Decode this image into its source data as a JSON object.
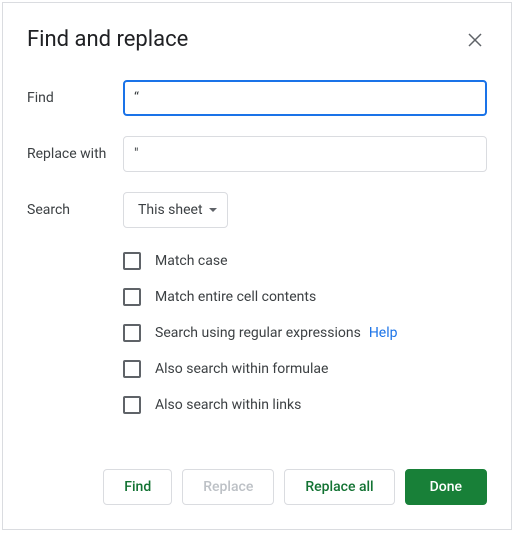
{
  "dialog": {
    "title": "Find and replace"
  },
  "fields": {
    "find_label": "Find",
    "find_value": "“",
    "replace_label": "Replace with",
    "replace_value": "\"",
    "search_label": "Search",
    "search_scope": "This sheet"
  },
  "options": {
    "match_case": "Match case",
    "match_entire": "Match entire cell contents",
    "regex": "Search using regular expressions",
    "regex_help": "Help",
    "formulae": "Also search within formulae",
    "links": "Also search within links"
  },
  "buttons": {
    "find": "Find",
    "replace": "Replace",
    "replace_all": "Replace all",
    "done": "Done"
  }
}
